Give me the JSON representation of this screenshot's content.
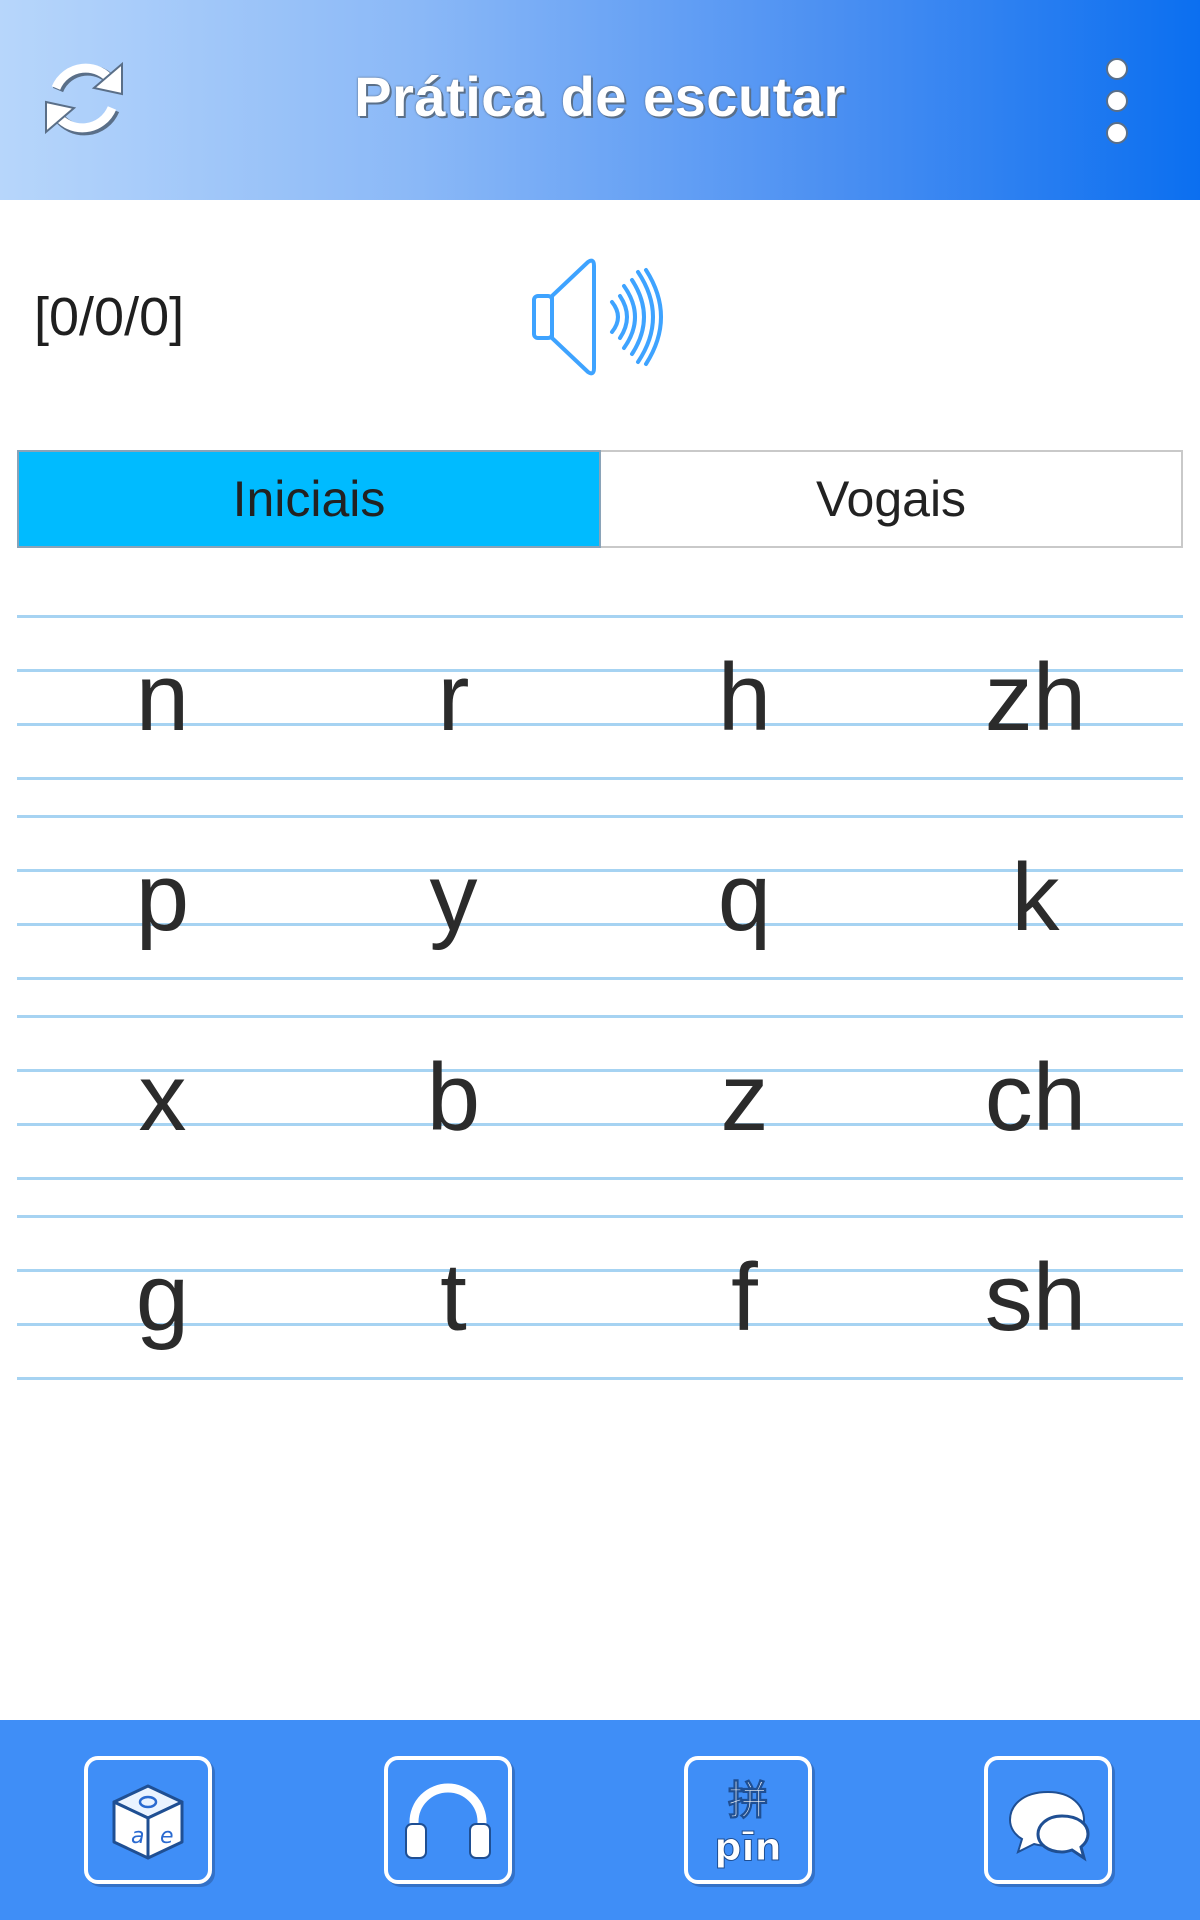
{
  "header": {
    "title": "Prática de escutar",
    "refresh_icon": "refresh-icon",
    "menu_icon": "more-vertical-icon"
  },
  "score": {
    "text": "[0/0/0]"
  },
  "speaker": {
    "icon": "speaker-volume-icon"
  },
  "segment": {
    "tabs": [
      {
        "label": "Iniciais",
        "selected": true
      },
      {
        "label": "Vogais",
        "selected": false
      }
    ]
  },
  "grid": {
    "rows": [
      [
        "n",
        "r",
        "h",
        "zh"
      ],
      [
        "p",
        "y",
        "q",
        "k"
      ],
      [
        "x",
        "b",
        "z",
        "ch"
      ],
      [
        "g",
        "t",
        "f",
        "sh"
      ]
    ]
  },
  "footer": {
    "tabs": [
      {
        "icon": "letter-cube-icon"
      },
      {
        "icon": "headphones-icon"
      },
      {
        "icon": "pinyin-icon",
        "glyph": "拼",
        "text": "pīn"
      },
      {
        "icon": "chat-bubbles-icon"
      }
    ]
  },
  "colors": {
    "header_start": "#b7d6fb",
    "header_end": "#0b6ff0",
    "segment_active": "#00bbff",
    "grid_line": "#a6d3f2",
    "footer": "#3f8ef7"
  }
}
